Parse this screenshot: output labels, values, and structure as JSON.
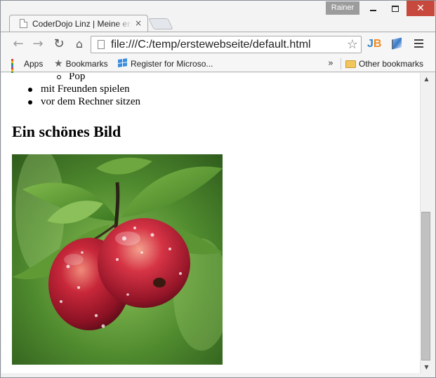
{
  "window": {
    "profile_name": "Rainer",
    "controls": {
      "minimize": "minimize",
      "maximize": "maximize",
      "close": "close"
    }
  },
  "tab": {
    "title": "CoderDojo Linz | Meine erste Webseite",
    "close_glyph": "×"
  },
  "toolbar": {
    "back_glyph": "←",
    "forward_glyph": "→",
    "reload_glyph": "↻",
    "home_glyph": "⌂",
    "url": "file:///C:/temp/erstewebseite/default.html",
    "star_glyph": "☆",
    "extension_jb": {
      "j": "J",
      "b": "B"
    }
  },
  "bookmarks": {
    "items": [
      {
        "label": "Apps",
        "icon": "apps-grid-icon"
      },
      {
        "label": "Bookmarks",
        "icon": "star-icon"
      },
      {
        "label": "Register for Microso...",
        "icon": "windows-logo-icon"
      }
    ],
    "overflow_glyph": "»",
    "other_label": "Other bookmarks"
  },
  "page": {
    "nested_item": "Pop",
    "list_items": [
      "mit Freunden spielen",
      "vor dem Rechner sitzen"
    ],
    "heading": "Ein schönes Bild",
    "image": "apple-photo"
  },
  "scrollbar": {
    "up_glyph": "▲",
    "down_glyph": "▼",
    "scroll_position": 0.93
  },
  "colors": {
    "close_button": "#c7493d",
    "profile_badge": "#9c9c9c",
    "folder": "#f1c65b"
  }
}
